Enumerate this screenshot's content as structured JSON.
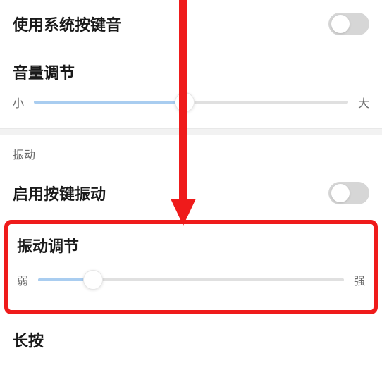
{
  "sound": {
    "system_key_sound_label": "使用系统按键音",
    "system_key_sound_on": false,
    "volume_title": "音量调节",
    "volume_min_label": "小",
    "volume_max_label": "大",
    "volume_percent": 48
  },
  "vibration": {
    "section_label": "振动",
    "enable_label": "启用按键振动",
    "enable_on": false,
    "adjust_title": "振动调节",
    "adjust_min_label": "弱",
    "adjust_max_label": "强",
    "adjust_percent": 18
  },
  "longpress_label": "长按",
  "annotation": {
    "arrow_color": "#ef1b1b",
    "highlight_color": "#ef1b1b"
  }
}
